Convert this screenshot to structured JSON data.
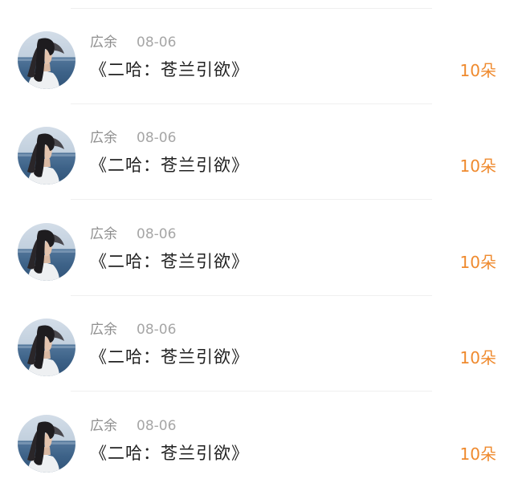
{
  "list": {
    "items": [
      {
        "name": "広余",
        "date": "08-06",
        "title": "《二哈：苍兰引欲》",
        "amount": "10朵"
      },
      {
        "name": "広余",
        "date": "08-06",
        "title": "《二哈：苍兰引欲》",
        "amount": "10朵"
      },
      {
        "name": "広余",
        "date": "08-06",
        "title": "《二哈：苍兰引欲》",
        "amount": "10朵"
      },
      {
        "name": "広余",
        "date": "08-06",
        "title": "《二哈：苍兰引欲》",
        "amount": "10朵"
      },
      {
        "name": "広余",
        "date": "08-06",
        "title": "《二哈：苍兰引欲》",
        "amount": "10朵"
      }
    ]
  },
  "colors": {
    "amount": "#ef8a2e",
    "name": "#8e8e8e",
    "title": "#222222",
    "divider": "#efefef"
  }
}
